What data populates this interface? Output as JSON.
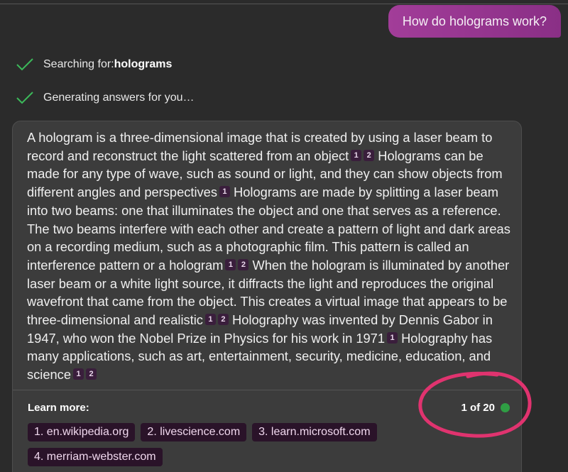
{
  "user_message": "How do holograms work?",
  "progress": [
    {
      "text": "Searching for: ",
      "bold": "holograms"
    },
    {
      "text": "Generating answers for you…",
      "bold": ""
    }
  ],
  "answer": [
    {
      "text": "A hologram is a three-dimensional image that is created by using a laser beam to record and reconstruct the light scattered from an object",
      "cites": [
        "1",
        "2"
      ]
    },
    {
      "text": " Holograms can be made for any type of wave, such as sound or light, and they can show objects from different angles and perspectives",
      "cites": [
        "1"
      ]
    },
    {
      "text": " Holograms are made by splitting a laser beam into two beams: one that illuminates the object and one that serves as a reference. The two beams interfere with each other and create a pattern of light and dark areas on a recording medium, such as a photographic film. This pattern is called an interference pattern or a hologram",
      "cites": [
        "1",
        "2"
      ]
    },
    {
      "text": " When the hologram is illuminated by another laser beam or a white light source, it diffracts the light and reproduces the original wavefront that came from the object. This creates a virtual image that appears to be three-dimensional and realistic",
      "cites": [
        "1",
        "2"
      ]
    },
    {
      "text": " Holography was invented by Dennis Gabor in 1947, who won the Nobel Prize in Physics for his work in 1971",
      "cites": [
        "1"
      ]
    },
    {
      "text": " Holography has many applications, such as art, entertainment, security, medicine, education, and science",
      "cites": [
        "1",
        "2"
      ]
    }
  ],
  "learn_more": {
    "label": "Learn more:",
    "counter": "1 of 20",
    "links": [
      "1. en.wikipedia.org",
      "2. livescience.com",
      "3. learn.microsoft.com",
      "4. merriam-webster.com"
    ]
  },
  "colors": {
    "background": "#2b2b2b",
    "user_bubble": "#a23d99",
    "check": "#3cb95a",
    "status_dot": "#2f9e44",
    "annotation_ink": "#e0336f"
  }
}
